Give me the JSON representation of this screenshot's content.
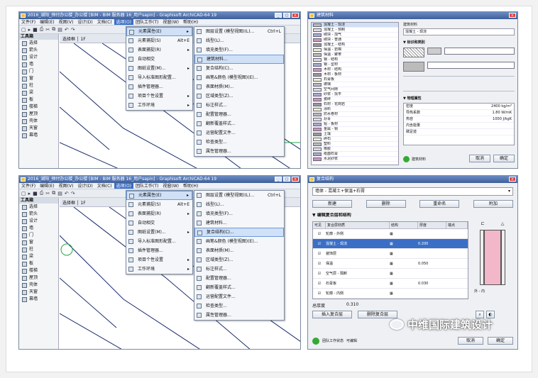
{
  "screens": {
    "top_left": {
      "title": "2016_湖阳_预付办公楼_办公楼 [BIM - BIM 服务器 16_用户sapin] - Graphisoft ArchiCAD-64 19",
      "menu": [
        "文件(F)",
        "编辑(E)",
        "视图(V)",
        "设计(D)",
        "文档(C)",
        "选项(O)",
        "团队工作(T)",
        "视窗(W)",
        "帮助(H)"
      ],
      "active_menu": "选项(O)",
      "toolbox_title": "工具箱",
      "toolbox_items": [
        "选择",
        "箭头",
        "设计",
        "墙",
        "门",
        "窗",
        "柱",
        "梁",
        "板",
        "楼梯",
        "屋顶",
        "壳体",
        "天窗",
        "幕墙"
      ],
      "info_bar": "选择框 │ 1F",
      "options_menu": [
        {
          "label": "元素属性(E)",
          "hl": true,
          "sub": true
        },
        {
          "label": "元素捕捉(S)",
          "shortcut": "Alt+E",
          "sub": true
        },
        {
          "label": "表面捕捉(R)",
          "sub": true
        },
        {
          "label": "自动相交"
        },
        {
          "label": "图纸设置(M)...",
          "sub": true
        },
        {
          "label": "导入标准图形配置..."
        },
        {
          "label": "插件管理器..."
        },
        {
          "label": "项目个性设置",
          "sub": true
        },
        {
          "label": "工作环境",
          "sub": true
        }
      ],
      "attr_submenu": [
        {
          "label": "图层设置 (模型视图)(L)...",
          "shortcut": "Ctrl+L"
        },
        {
          "label": "线型(L)..."
        },
        {
          "label": "填充类型(F)..."
        },
        {
          "label": "建筑材料...",
          "hl": true
        },
        {
          "label": "复合结构(C)..."
        },
        {
          "label": "画笔&颜色 (模型视图)(E)..."
        },
        {
          "label": "表面材质(M)..."
        },
        {
          "label": "区域类型(Z)..."
        },
        {
          "label": "标注样式..."
        },
        {
          "label": "配置管理器..."
        },
        {
          "label": "翻新覆盖样式..."
        },
        {
          "label": "运营配置文件..."
        },
        {
          "label": "检查类型..."
        },
        {
          "label": "属性管理器..."
        }
      ]
    },
    "top_right": {
      "title": "建筑材料",
      "panel_header": "建筑材料",
      "materials": [
        "混凝土 - 现浇",
        "混凝土 - 预制",
        "砌块 - 加气",
        "砌块 - 普通",
        "混凝土 - 结构",
        "保温 - 岩棉",
        "保温 - 聚苯",
        "钢 - 结构",
        "钢 - 型材",
        "木材 - 结构",
        "木材 - 板材",
        "石膏板",
        "玻璃",
        "空气间隙",
        "砂浆 - 找平",
        "瓷砖",
        "石材 - 花岗岩",
        "涂料",
        "防水卷材",
        "沥青",
        "铝 - 板材",
        "金属 - 铜",
        "土壤",
        "碎石",
        "塑料",
        "橡胶",
        "纸面石膏",
        "水泥砂浆"
      ],
      "name_field": "混凝土 - 现浇",
      "section_id": "▼ 标识和类别",
      "section_phys": "▼ 物理属性",
      "rows": [
        "密度",
        "导热系数",
        "热容",
        "内含能量",
        "碳足迹"
      ],
      "values": [
        "2400 kg/m³",
        "1.80 W/mK",
        "1000 J/kgK"
      ],
      "ok": "确定",
      "cancel": "取消",
      "check": "建筑材料"
    },
    "bottom_left": {
      "title": "2016_湖阳_预付办公楼_办公楼 [BIM - BIM 服务器 16_用户sapin] - Graphisoft ArchiCAD-64 19",
      "menu": [
        "文件(F)",
        "编辑(E)",
        "视图(V)",
        "设计(D)",
        "文档(C)",
        "选项(O)",
        "团队工作(T)",
        "视窗(W)",
        "帮助(H)"
      ],
      "active_menu": "选项(O)",
      "toolbox_title": "工具箱",
      "toolbox_items": [
        "选择",
        "箭头",
        "设计",
        "墙",
        "门",
        "窗",
        "柱",
        "梁",
        "板",
        "楼梯",
        "屋顶",
        "壳体",
        "天窗",
        "幕墙"
      ],
      "info_bar": "选择框 │ 1F",
      "options_menu": [
        {
          "label": "元素属性(E)",
          "hl": true,
          "sub": true
        },
        {
          "label": "元素捕捉(S)",
          "shortcut": "Alt+E",
          "sub": true
        },
        {
          "label": "表面捕捉(R)",
          "sub": true
        },
        {
          "label": "自动相交"
        },
        {
          "label": "图纸设置(M)...",
          "sub": true
        },
        {
          "label": "导入标准图形配置..."
        },
        {
          "label": "插件管理器..."
        },
        {
          "label": "项目个性设置",
          "sub": true
        },
        {
          "label": "工作环境",
          "sub": true
        }
      ],
      "attr_submenu": [
        {
          "label": "图层设置 (模型视图)(L)...",
          "shortcut": "Ctrl+L"
        },
        {
          "label": "线型(L)..."
        },
        {
          "label": "填充类型(F)..."
        },
        {
          "label": "建筑材料..."
        },
        {
          "label": "复合结构(C)...",
          "hl": true
        },
        {
          "label": "画笔&颜色 (模型视图)(E)..."
        },
        {
          "label": "表面材质(M)..."
        },
        {
          "label": "区域类型(Z)..."
        },
        {
          "label": "标注样式..."
        },
        {
          "label": "配置管理器..."
        },
        {
          "label": "翻新覆盖样式..."
        },
        {
          "label": "运营配置文件..."
        },
        {
          "label": "检查类型..."
        },
        {
          "label": "属性管理器..."
        }
      ]
    },
    "bottom_right": {
      "title": "复合结构",
      "dropdown": "墙体 - 混凝土+保温+石膏",
      "buttons": [
        "新建",
        "删除",
        "重命名",
        "附加"
      ],
      "section": "▼ 编辑复合层和结构",
      "cols": [
        "可见",
        "复合层材质",
        "结构",
        "厚度",
        "端点"
      ],
      "layers": [
        {
          "name": "轮廓 - 外侧",
          "thick": "",
          "hl": false
        },
        {
          "name": "混凝土 - 现浇",
          "thick": "0.200",
          "hl": true
        },
        {
          "name": "装饰层",
          "thick": "",
          "hl": false
        },
        {
          "name": "保温",
          "thick": "0.050",
          "hl": false
        },
        {
          "name": "空气层 - 隔断",
          "thick": "",
          "hl": false
        },
        {
          "name": "石膏板",
          "thick": "0.030",
          "hl": false
        },
        {
          "name": "轮廓 - 内侧",
          "thick": "",
          "hl": false
        }
      ],
      "total_label": "总厚度",
      "total": "0.310",
      "insert_btn": "插入复合层",
      "delete_btn": "删除复合层",
      "side_label": "外 - 内",
      "ok": "确定",
      "cancel": "取消",
      "footer": "团队工作状态",
      "footer2": "可编辑"
    }
  },
  "watermark": "中维国际建筑设计"
}
